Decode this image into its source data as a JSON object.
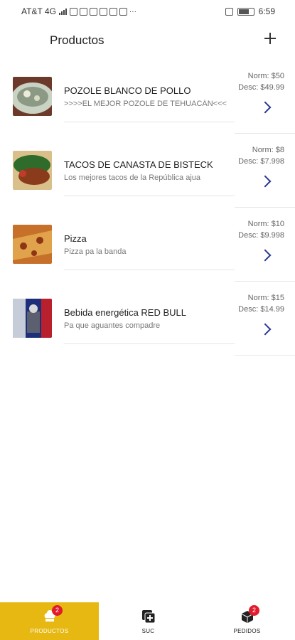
{
  "status_bar": {
    "carrier": "AT&T 4G",
    "time": "6:59"
  },
  "header": {
    "title": "Productos",
    "add_icon": "plus-icon"
  },
  "products": [
    {
      "name": "POZOLE BLANCO DE POLLO",
      "description": ">>>>EL MEJOR POZOLE DE TEHUACÁN<<<",
      "price_normal": "Norm: $50",
      "price_discount": "Desc: $49.99",
      "thumb_colors": [
        "#8c9a85",
        "#c9d2c3",
        "#6b3a2a"
      ]
    },
    {
      "name": "TACOS DE CANASTA DE BISTECK",
      "description": "Los mejores tacos de la República ajua",
      "price_normal": "Norm: $8",
      "price_discount": "Desc: $7.998",
      "thumb_colors": [
        "#2f6b2a",
        "#8a3b1c",
        "#d9c08a"
      ]
    },
    {
      "name": "Pizza",
      "description": "Pizza pa la banda",
      "price_normal": "Norm: $10",
      "price_discount": "Desc: $9.998",
      "thumb_colors": [
        "#c6702a",
        "#e0a24a",
        "#8e3516"
      ]
    },
    {
      "name": "Bebida energética RED BULL",
      "description": "Pa que aguantes compadre",
      "price_normal": "Norm: $15",
      "price_discount": "Desc: $14.99",
      "thumb_colors": [
        "#1d2f7a",
        "#c7ccd9",
        "#b8202e"
      ]
    }
  ],
  "bottom_nav": [
    {
      "label": "PRODUCTOS",
      "icon": "chef-hat-icon",
      "badge": "2",
      "active": true
    },
    {
      "label": "SUC",
      "icon": "add-box-icon",
      "badge": "",
      "active": false
    },
    {
      "label": "PEDIDOS",
      "icon": "box-icon",
      "badge": "2",
      "active": false
    }
  ],
  "colors": {
    "accent": "#e6b811",
    "chevron": "#2b3990",
    "badge": "#e21b2c"
  }
}
